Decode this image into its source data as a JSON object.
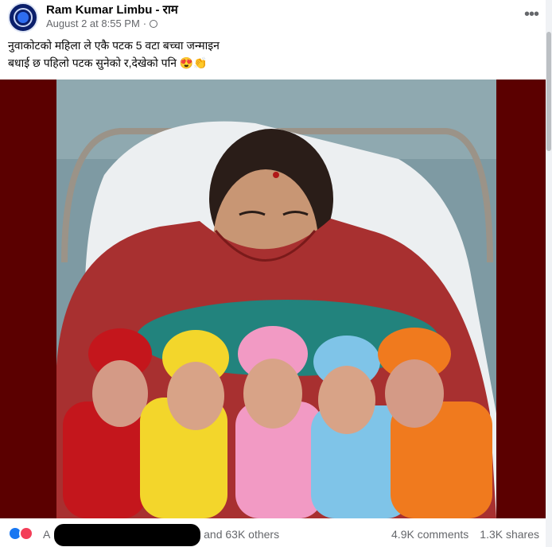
{
  "post": {
    "author": "Ram Kumar Limbu - राम",
    "timestamp": "August 2 at 8:55 PM",
    "separator": "·",
    "more_icon": "more-horizontal-icon",
    "text_line1": "नुवाकोटको महिला ले एकै पटक 5 वटा बच्चा जन्माइन",
    "text_line2": "बधाई छ पहिलो पटक सुनेको र,देखेको पनि 😍👏"
  },
  "photo": {
    "hat_colors": [
      "#c4161c",
      "#f3d62b",
      "#f29ac4",
      "#7fc4e8",
      "#f07a1e"
    ]
  },
  "footer": {
    "reactions_prefix": "A",
    "reactions_suffix": "al and 63K others",
    "comments": "4.9K comments",
    "shares": "1.3K shares",
    "reaction_icons": [
      "like-icon",
      "love-icon"
    ]
  }
}
